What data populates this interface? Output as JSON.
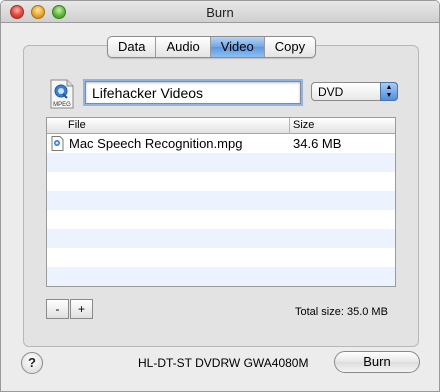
{
  "window": {
    "title": "Burn"
  },
  "tabs": [
    {
      "label": "Data",
      "selected": false
    },
    {
      "label": "Audio",
      "selected": false
    },
    {
      "label": "Video",
      "selected": true
    },
    {
      "label": "Copy",
      "selected": false
    }
  ],
  "disc": {
    "icon": "mpeg-document-icon",
    "icon_caption": "MPEG",
    "name_value": "Lifehacker Videos",
    "format_selected": "DVD"
  },
  "table": {
    "columns": [
      "File",
      "Size"
    ],
    "rows": [
      {
        "file": "Mac Speech Recognition.mpg",
        "size": "34.6 MB",
        "icon": "quicktime-file-icon"
      }
    ]
  },
  "footer": {
    "remove_label": "-",
    "add_label": "+",
    "total_size": "Total size: 35.0 MB",
    "help_label": "?",
    "drive_name": "HL-DT-ST DVDRW GWA4080M",
    "burn_label": "Burn"
  },
  "colors": {
    "selected_tab": "#6fa6e6",
    "alt_row": "#edf3fe",
    "focus_ring": "#8fb5e8"
  }
}
